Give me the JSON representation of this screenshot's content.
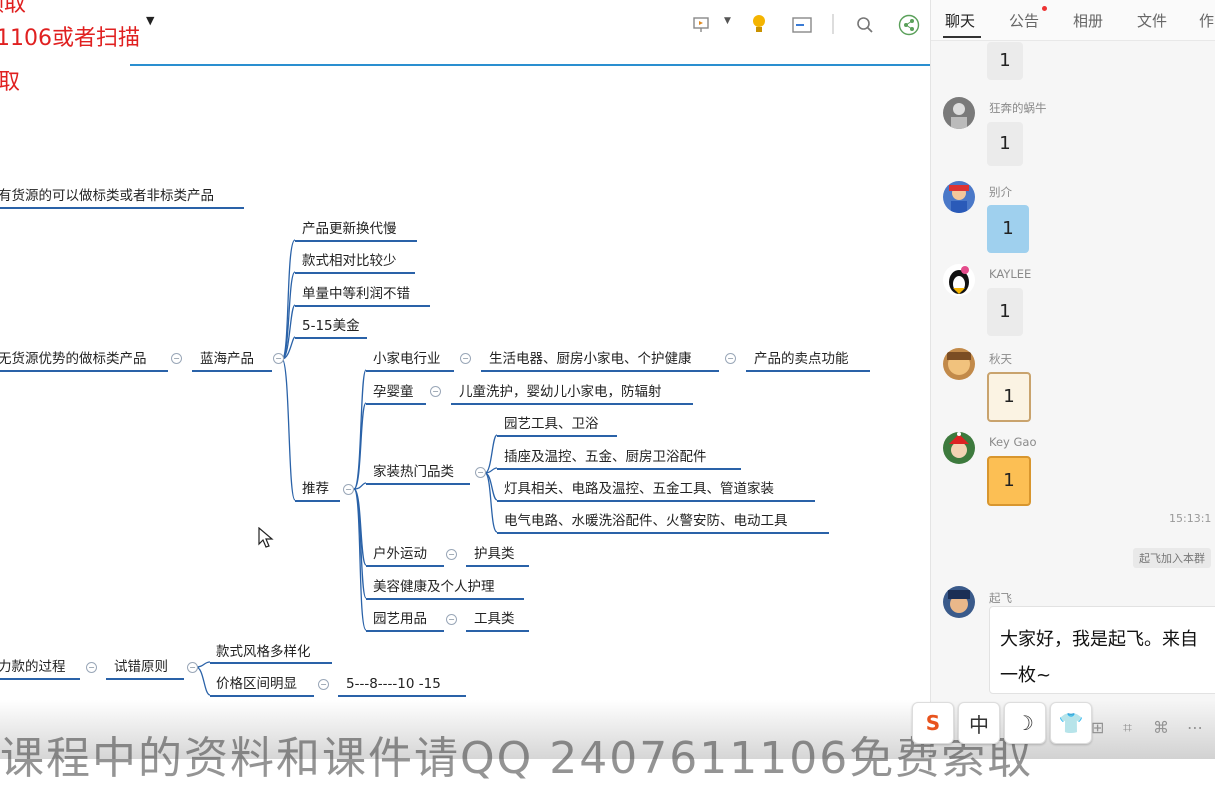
{
  "overlay": {
    "line1": "资料领取",
    "line2": "1106或者扫描",
    "line3": "获取"
  },
  "toolbar": {
    "present_icon": "presentation-icon",
    "idea_icon": "lightbulb-icon",
    "panel_icon": "panel-icon",
    "search_icon": "search-icon",
    "share_icon": "share-icon"
  },
  "mindmap": {
    "branch_top": "有货源的可以做标类或者非标类产品",
    "branch_main": "无货源优势的做标类产品",
    "blue_ocean": "蓝海产品",
    "bo_children": [
      "产品更新换代慢",
      "款式相对比较少",
      "单量中等利润不错",
      "5-15美金"
    ],
    "recommend": "推荐",
    "small_appliance": "小家电行业",
    "small_appliance_child": "生活电器、厨房小家电、个护健康",
    "selling_point": "产品的卖点功能",
    "baby": "孕婴童",
    "baby_child": "儿童洗护，婴幼儿小家电，防辐射",
    "home": "家装热门品类",
    "home_children": [
      "园艺工具、卫浴",
      "插座及温控、五金、厨房卫浴配件",
      "灯具相关、电路及温控、五金工具、管道家装",
      "电气电路、水暖洗浴配件、火警安防、电动工具"
    ],
    "outdoor": "户外运动",
    "outdoor_child": "护具类",
    "beauty": "美容健康及个人护理",
    "garden": "园艺用品",
    "garden_child": "工具类",
    "process": "力款的过程",
    "trial": "试错原则",
    "style": "款式风格多样化",
    "price": "价格区间明显",
    "price_child": "5---8----10  -15"
  },
  "subtitle": "课程中的资料和课件请QQ 2407611106免费索取",
  "chat": {
    "tabs": [
      "聊天",
      "公告",
      "相册",
      "文件",
      "作"
    ],
    "messages": [
      {
        "nick": "",
        "text": "1"
      },
      {
        "nick": "狂奔的蜗牛",
        "text": "1"
      },
      {
        "nick": "别介",
        "text": "1"
      },
      {
        "nick": "KAYLEE",
        "text": "1"
      },
      {
        "nick": "秋天",
        "text": "1"
      },
      {
        "nick": "Key Gao",
        "text": "1"
      }
    ],
    "time": "15:13:1",
    "system": "起飞加入本群",
    "last_nick": "起飞",
    "input_line1": "大家好，我是起飞。来自",
    "input_line2": "一枚~"
  },
  "ime": [
    "S",
    "中",
    "☽",
    "👕"
  ]
}
